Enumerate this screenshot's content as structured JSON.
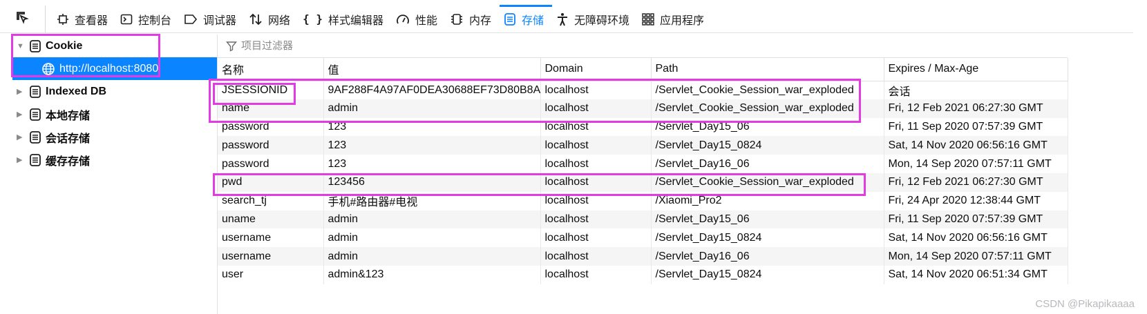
{
  "toolbar": {
    "tabs": [
      {
        "label": "查看器",
        "icon": "inspector-icon"
      },
      {
        "label": "控制台",
        "icon": "console-icon"
      },
      {
        "label": "调试器",
        "icon": "debugger-icon"
      },
      {
        "label": "网络",
        "icon": "network-icon"
      },
      {
        "label": "样式编辑器",
        "icon": "style-editor-icon"
      },
      {
        "label": "性能",
        "icon": "performance-icon"
      },
      {
        "label": "内存",
        "icon": "memory-icon"
      },
      {
        "label": "存储",
        "icon": "storage-icon",
        "active": true
      },
      {
        "label": "无障碍环境",
        "icon": "accessibility-icon"
      },
      {
        "label": "应用程序",
        "icon": "application-icon"
      }
    ]
  },
  "sidebar": {
    "items": [
      {
        "label": "Cookie",
        "expanded": true
      },
      {
        "label": "http://localhost:8080",
        "selected": true
      },
      {
        "label": "Indexed DB"
      },
      {
        "label": "本地存储"
      },
      {
        "label": "会话存储"
      },
      {
        "label": "缓存存储"
      }
    ]
  },
  "filter": {
    "placeholder": "项目过滤器"
  },
  "table": {
    "columns": [
      "名称",
      "值",
      "Domain",
      "Path",
      "Expires / Max-Age"
    ],
    "rows": [
      [
        "JSESSIONID",
        "9AF288F4A97AF0DEA30688EF73D80B8A",
        "localhost",
        "/Servlet_Cookie_Session_war_exploded",
        "会话"
      ],
      [
        "name",
        "admin",
        "localhost",
        "/Servlet_Cookie_Session_war_exploded",
        "Fri, 12 Feb 2021 06:27:30 GMT"
      ],
      [
        "password",
        "123",
        "localhost",
        "/Servlet_Day15_06",
        "Fri, 11 Sep 2020 07:57:39 GMT"
      ],
      [
        "password",
        "123",
        "localhost",
        "/Servlet_Day15_0824",
        "Sat, 14 Nov 2020 06:56:16 GMT"
      ],
      [
        "password",
        "123",
        "localhost",
        "/Servlet_Day16_06",
        "Mon, 14 Sep 2020 07:57:11 GMT"
      ],
      [
        "pwd",
        "123456",
        "localhost",
        "/Servlet_Cookie_Session_war_exploded",
        "Fri, 12 Feb 2021 06:27:30 GMT"
      ],
      [
        "search_tj",
        "手机#路由器#电视",
        "localhost",
        "/Xiaomi_Pro2",
        "Fri, 24 Apr 2020 12:38:44 GMT"
      ],
      [
        "uname",
        "admin",
        "localhost",
        "/Servlet_Day15_06",
        "Fri, 11 Sep 2020 07:57:39 GMT"
      ],
      [
        "username",
        "admin",
        "localhost",
        "/Servlet_Day15_0824",
        "Sat, 14 Nov 2020 06:56:16 GMT"
      ],
      [
        "username",
        "admin",
        "localhost",
        "/Servlet_Day16_06",
        "Mon, 14 Sep 2020 07:57:11 GMT"
      ],
      [
        "user",
        "admin&123",
        "localhost",
        "/Servlet_Day15_0824",
        "Sat, 14 Nov 2020 06:51:34 GMT"
      ]
    ]
  },
  "colors": {
    "accent": "#0a84ff",
    "highlight": "#e33be3",
    "selected_text": "#ffffff"
  },
  "watermark": "CSDN @Pikapikaaaa"
}
